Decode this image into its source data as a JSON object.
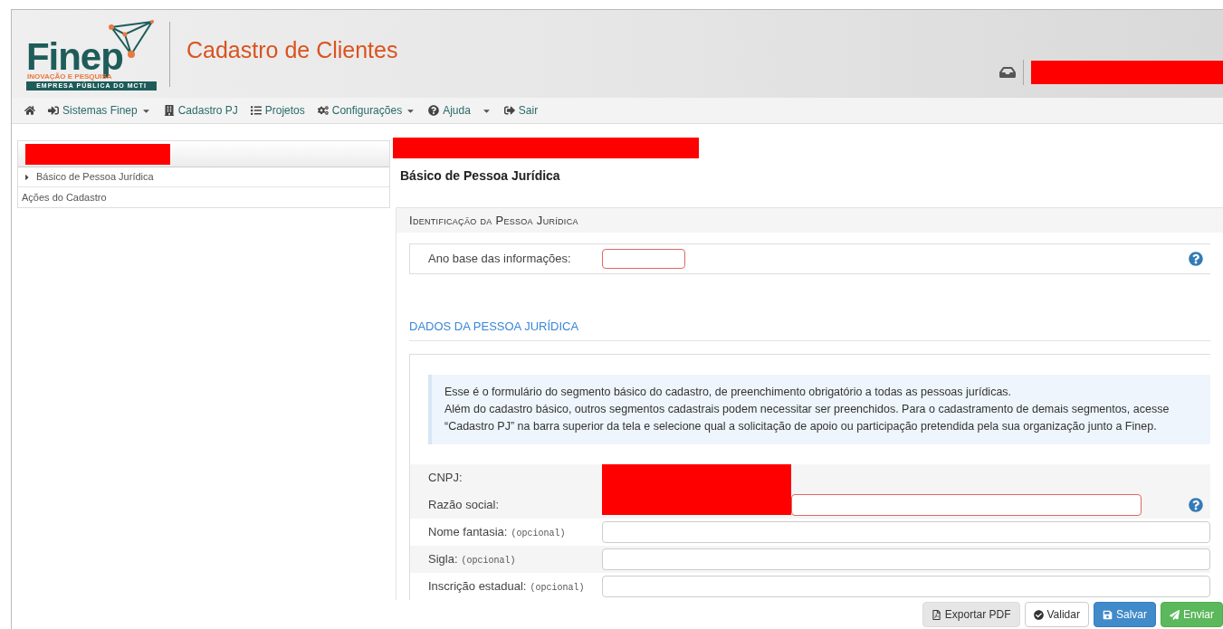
{
  "header": {
    "logo": {
      "wordmark": "Finep",
      "tagline": "INOVAÇÃO E PESQUISA",
      "band": "EMPRESA PÚBLICA DO MCTI"
    },
    "app_title": "Cadastro de Clientes"
  },
  "nav": [
    {
      "dropdown": false
    },
    {
      "label": "Sistemas Finep",
      "dropdown": true
    },
    {
      "label": "Cadastro PJ",
      "dropdown": false
    },
    {
      "label": "Projetos",
      "dropdown": false
    },
    {
      "label": "Configurações",
      "dropdown": true
    },
    {
      "label": "Ajuda",
      "dropdown": true
    },
    {
      "label": "Sair",
      "dropdown": false
    }
  ],
  "sidebar": {
    "items": [
      {
        "label": "Básico de Pessoa Jurídica",
        "kind": "group"
      },
      {
        "label": "Ações do Cadastro",
        "kind": "link"
      }
    ]
  },
  "main": {
    "page_title": "Básico de Pessoa Jurídica",
    "panel": {
      "heading": "Identificação da Pessoa Jurídica",
      "fields": [
        {
          "label": "Ano base das informações:",
          "invalid": true,
          "help": true
        }
      ]
    },
    "section_title": "DADOS DA PESSOA JURÍDICA",
    "info": [
      "Esse é o formulário do segmento básico do cadastro, de preenchimento obrigatório a todas as pessoas jurídicas.",
      "Além do cadastro básico, outros segmentos cadastrais podem necessitar ser preenchidos. Para o cadastramento de demais segmentos, acesse",
      "“Cadastro PJ” na barra superior da tela e selecione qual a solicitação de apoio ou participação pretendida pela sua organização junto a Finep."
    ],
    "fields": [
      {
        "label": "CNPJ:",
        "kind": "static"
      },
      {
        "label": "Razão social:",
        "kind": "input",
        "invalid": true,
        "help": true
      },
      {
        "label": "Nome fantasia:",
        "note": "(opcional)",
        "kind": "input",
        "invalid": false,
        "help": false
      },
      {
        "label": "Sigla:",
        "note": "(opcional)",
        "kind": "input",
        "invalid": false,
        "help": false
      },
      {
        "label": "Inscrição estadual:",
        "note": "(opcional)",
        "kind": "input",
        "invalid": false,
        "help": false
      }
    ]
  },
  "actions": [
    {
      "label": "Exportar PDF",
      "kind": "default"
    },
    {
      "label": "Validar",
      "kind": "outline"
    },
    {
      "label": "Salvar",
      "kind": "primary"
    },
    {
      "label": "Enviar",
      "kind": "success"
    }
  ]
}
